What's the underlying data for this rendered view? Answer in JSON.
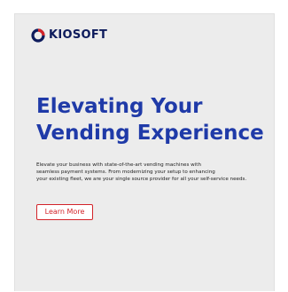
{
  "brand": {
    "name": "KIOSOFT",
    "logo_icon": "kiosoft-ring-icon",
    "text_color": "#0d1b5c",
    "ring_colors": [
      "#0d1b5c",
      "#d3242a"
    ]
  },
  "hero": {
    "headline_line1": "Elevating Your",
    "headline_line2": "Vending Experience",
    "headline_color": "#1f3aa8",
    "body_line1": "Elevate your business with state-of-the-art vending machines with",
    "body_line2": "seamless payment systems. From modernizing your setup to enhancing",
    "body_line3": "your existing fleet, we are your single source provider for all your self-service needs.",
    "cta_label": "Learn More",
    "cta_color": "#d3242a"
  }
}
